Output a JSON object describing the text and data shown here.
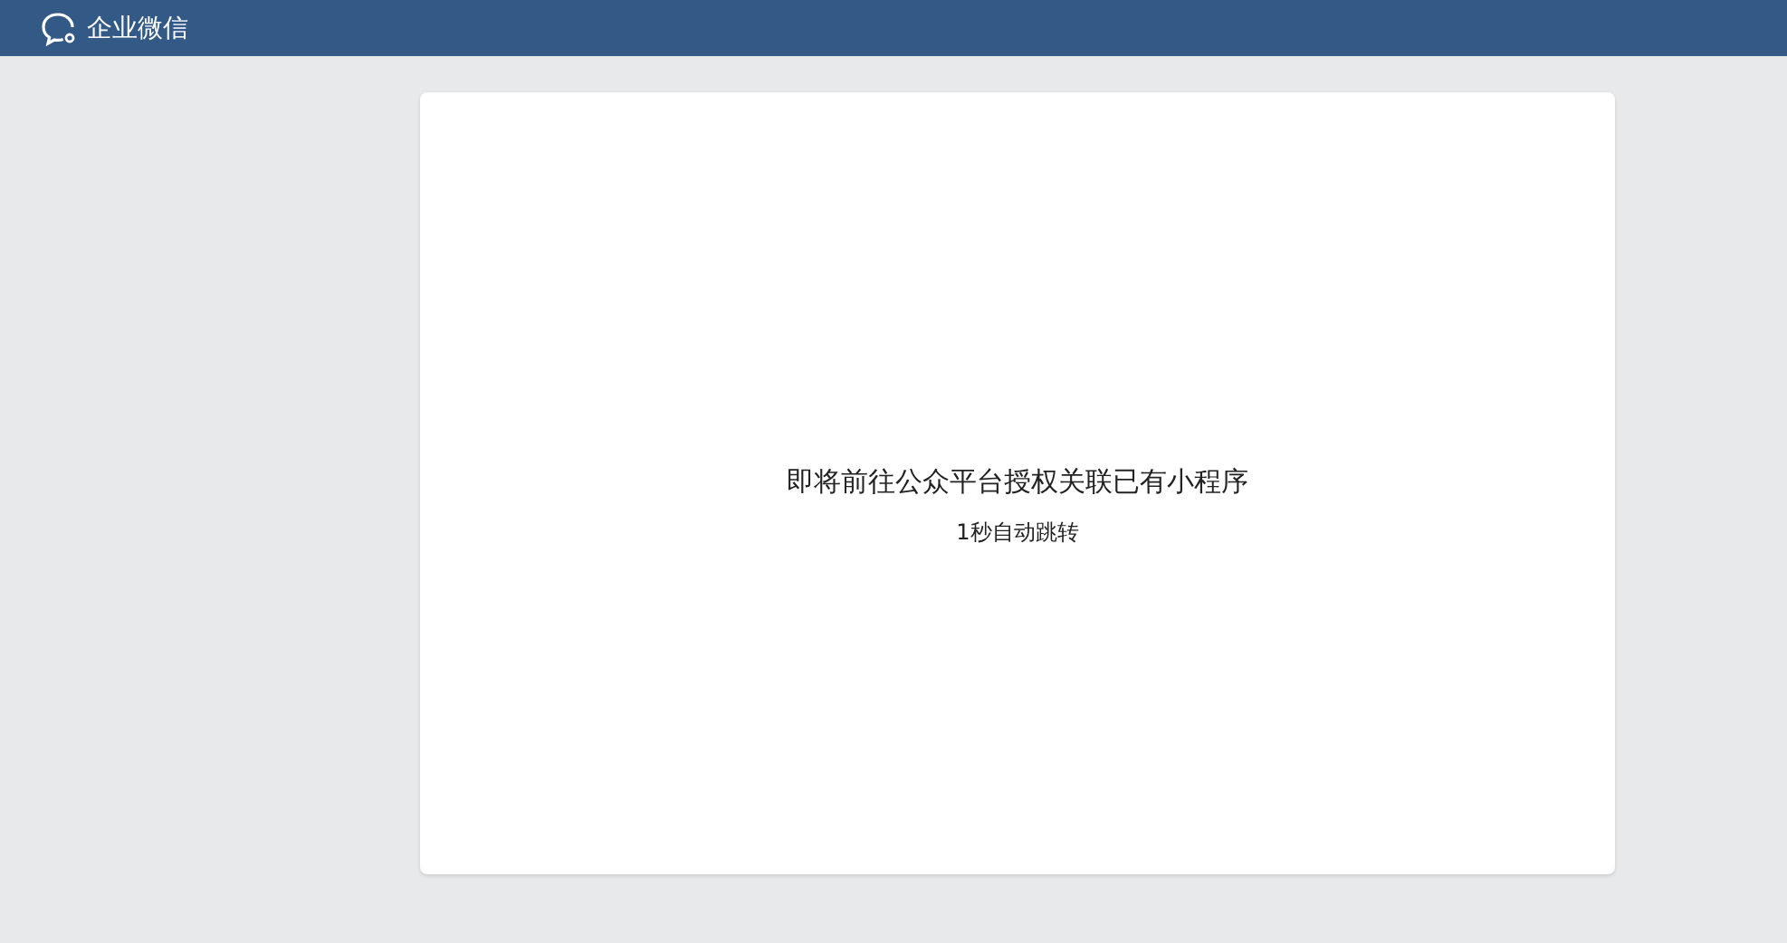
{
  "header": {
    "brand": "企业微信"
  },
  "notice": {
    "message": "即将前往公众平台授权关联已有小程序",
    "countdown": "1秒自动跳转"
  }
}
